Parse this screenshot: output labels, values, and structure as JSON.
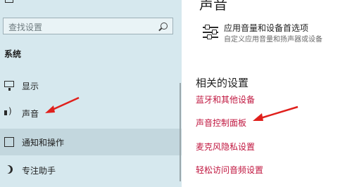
{
  "sidebar": {
    "search_placeholder": "查找设置",
    "section_label": "系统",
    "items": [
      {
        "label": "显示",
        "icon": "monitor-icon"
      },
      {
        "label": "声音",
        "icon": "speaker-icon"
      },
      {
        "label": "通知和操作",
        "icon": "notification-icon"
      },
      {
        "label": "专注助手",
        "icon": "moon-icon"
      }
    ]
  },
  "main": {
    "title": "声音",
    "option": {
      "title": "应用音量和设备首选项",
      "description": "自定义应用音量和扬声器或设备"
    },
    "related": {
      "title": "相关的设置",
      "links": [
        "蓝牙和其他设备",
        "声音控制面板",
        "麦克风隐私设置",
        "轻松访问音频设置"
      ]
    }
  },
  "colors": {
    "sidebar_bg": "#d6e8ee",
    "link": "#c0163f",
    "annotation_arrow": "#e0201c"
  }
}
